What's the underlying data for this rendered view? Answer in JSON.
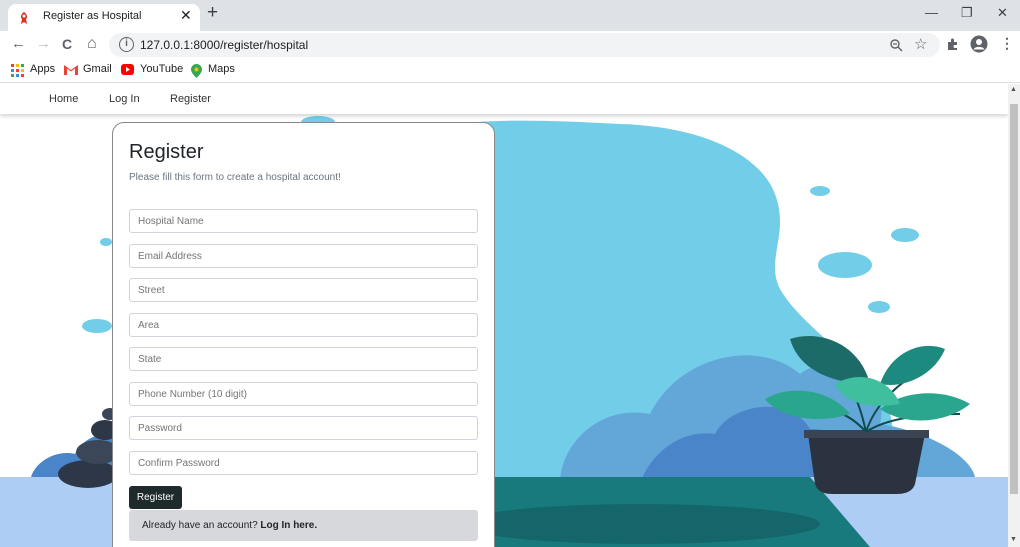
{
  "browser": {
    "tab_title": "Register as Hospital",
    "tab_close": "✕",
    "new_tab": "+",
    "url": "127.0.0.1:8000/register/hospital",
    "window_controls": {
      "minimize": "—",
      "restore": "❐",
      "close": "✕"
    },
    "nav": {
      "back": "←",
      "forward": "→",
      "reload": "C",
      "home": "⌂"
    },
    "bookmarks": [
      {
        "label": "Apps",
        "icon": "apps-grid-icon"
      },
      {
        "label": "Gmail",
        "icon": "gmail-icon"
      },
      {
        "label": "YouTube",
        "icon": "youtube-icon"
      },
      {
        "label": "Maps",
        "icon": "maps-icon"
      }
    ]
  },
  "site_nav": {
    "links": [
      "Home",
      "Log In",
      "Register"
    ]
  },
  "form": {
    "title": "Register",
    "subtitle": "Please fill this form to create a hospital account!",
    "fields": [
      {
        "placeholder": "Hospital Name"
      },
      {
        "placeholder": "Email Address"
      },
      {
        "placeholder": "Street"
      },
      {
        "placeholder": "Area"
      },
      {
        "placeholder": "State"
      },
      {
        "placeholder": "Phone Number (10 digit)"
      },
      {
        "placeholder": "Password"
      },
      {
        "placeholder": "Confirm Password"
      }
    ],
    "submit_label": "Register",
    "login_prompt": "Already have an account?",
    "login_link": "Log In here."
  },
  "colors": {
    "accent_dark": "#1f2a2d",
    "blob_blue": "#72cde8",
    "ground": "#aecdf5",
    "teal": "#197a7e"
  }
}
